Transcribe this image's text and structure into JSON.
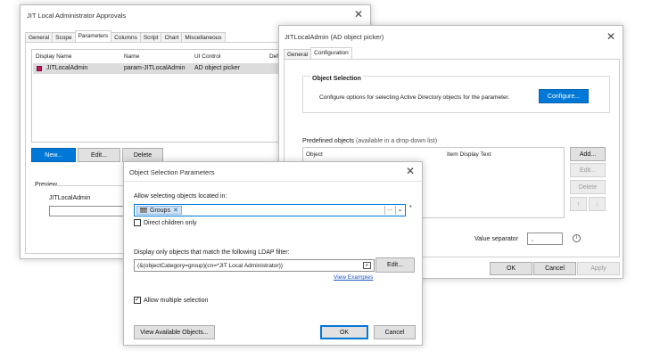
{
  "main_window": {
    "title": "JIT Local Administrator Approvals",
    "tabs": [
      "General",
      "Scope",
      "Parameters",
      "Columns",
      "Script",
      "Chart",
      "Miscellaneous"
    ],
    "active_tab": "Parameters",
    "table": {
      "columns": [
        "Display Name",
        "Name",
        "UI Control",
        "Defa"
      ],
      "rows": [
        {
          "display_name": "JITLocalAdmin",
          "name": "param-JITLocalAdmin",
          "ui_control": "AD object picker"
        }
      ]
    },
    "buttons": {
      "new": "New...",
      "edit": "Edit...",
      "delete": "Delete"
    },
    "preview": {
      "label": "Preview",
      "field_label": "JITLocalAdmin"
    }
  },
  "picker_window": {
    "title": "JITLocalAdmin (AD object picker)",
    "tabs": [
      "General",
      "Configuration"
    ],
    "active_tab": "Configuration",
    "object_selection": {
      "heading": "Object Selection",
      "description": "Configure options for selecting Active Directory objects for the parameter.",
      "configure_button": "Configure..."
    },
    "predefined": {
      "label": "Predefined objects",
      "hint": "(available in a drop-down list)",
      "columns": [
        "Object",
        "Item Display Text"
      ],
      "buttons": {
        "add": "Add...",
        "edit": "Edit...",
        "delete": "Delete"
      }
    },
    "value_separator": {
      "label": "Value separator",
      "value": ","
    },
    "footer": {
      "ok": "OK",
      "cancel": "Cancel",
      "apply": "Apply"
    }
  },
  "params_dialog": {
    "title": "Object Selection Parameters",
    "location_label": "Allow selecting objects located in:",
    "location_chip": "Groups",
    "browse_label": "...",
    "required_mark": "*",
    "direct_children": {
      "label": "Direct children only",
      "checked": false
    },
    "ldap_label": "Display only objects that match the following LDAP filter:",
    "ldap_value": "(&(objectCategory=group)(cn=*JIT Local Administrator))",
    "ldap_edit": "Edit...",
    "view_examples": "View Examples",
    "multiple": {
      "label": "Allow multiple selection",
      "checked": true
    },
    "view_available": "View Available Objects...",
    "ok": "OK",
    "cancel": "Cancel"
  },
  "colors": {
    "accent": "#0078d7",
    "selection": "#dcdcdc",
    "link": "#1a57c6"
  }
}
